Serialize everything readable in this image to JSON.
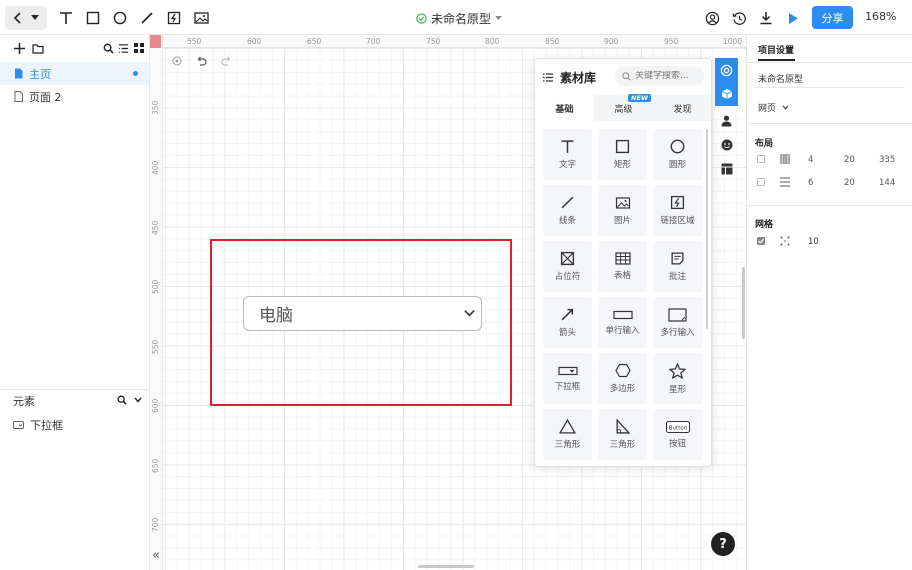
{
  "toolbar": {
    "document_title": "未命名原型",
    "share_label": "分享",
    "zoom_label": "168%"
  },
  "left_panel": {
    "pages": [
      {
        "label": "主页",
        "active": true
      },
      {
        "label": "页面 2",
        "active": false
      }
    ],
    "elements_header": "元素",
    "elements": [
      {
        "label": "下拉框"
      }
    ],
    "collapse_glyph": "«"
  },
  "canvas": {
    "ruler_top": [
      "550",
      "600",
      "650",
      "700",
      "750",
      "800",
      "850",
      "900",
      "950",
      "1000"
    ],
    "ruler_left": [
      "350",
      "400",
      "450",
      "500",
      "550",
      "600",
      "650",
      "700"
    ],
    "dropdown_value": "电脑",
    "help_label": "?"
  },
  "library": {
    "title": "素材库",
    "search_placeholder": "关键字搜索...",
    "tabs": [
      {
        "label": "基础",
        "badge": ""
      },
      {
        "label": "高级",
        "badge": "NEW"
      },
      {
        "label": "发现",
        "badge": ""
      }
    ],
    "items": [
      {
        "label": "文字",
        "icon": "text-icon"
      },
      {
        "label": "矩形",
        "icon": "rectangle-icon"
      },
      {
        "label": "圆形",
        "icon": "circle-icon"
      },
      {
        "label": "线条",
        "icon": "line-icon"
      },
      {
        "label": "图片",
        "icon": "image-icon"
      },
      {
        "label": "链接区域",
        "icon": "link-area-icon"
      },
      {
        "label": "占位符",
        "icon": "placeholder-icon"
      },
      {
        "label": "表格",
        "icon": "table-icon"
      },
      {
        "label": "批注",
        "icon": "note-icon"
      },
      {
        "label": "箭头",
        "icon": "arrow-icon"
      },
      {
        "label": "单行输入",
        "icon": "single-input-icon"
      },
      {
        "label": "多行输入",
        "icon": "multiline-input-icon"
      },
      {
        "label": "下拉框",
        "icon": "dropdown-icon"
      },
      {
        "label": "多边形",
        "icon": "polygon-icon"
      },
      {
        "label": "星形",
        "icon": "star-icon"
      },
      {
        "label": "三角形",
        "icon": "triangle-icon"
      },
      {
        "label": "三角形",
        "icon": "right-triangle-icon"
      },
      {
        "label": "按钮",
        "icon": "button-icon",
        "icon_text": "Button"
      }
    ]
  },
  "right_panel": {
    "tab_label": "项目设置",
    "project_name": "未命名原型",
    "page_type": "网页",
    "layout_header": "布局",
    "layout_rows": [
      {
        "a": "4",
        "b": "20",
        "c": "335"
      },
      {
        "a": "6",
        "b": "20",
        "c": "144"
      }
    ],
    "grid_header": "网格",
    "grid_size": "10"
  },
  "colors": {
    "accent": "#2d8cf0",
    "selection": "#d9252a",
    "success": "#2fb344"
  }
}
